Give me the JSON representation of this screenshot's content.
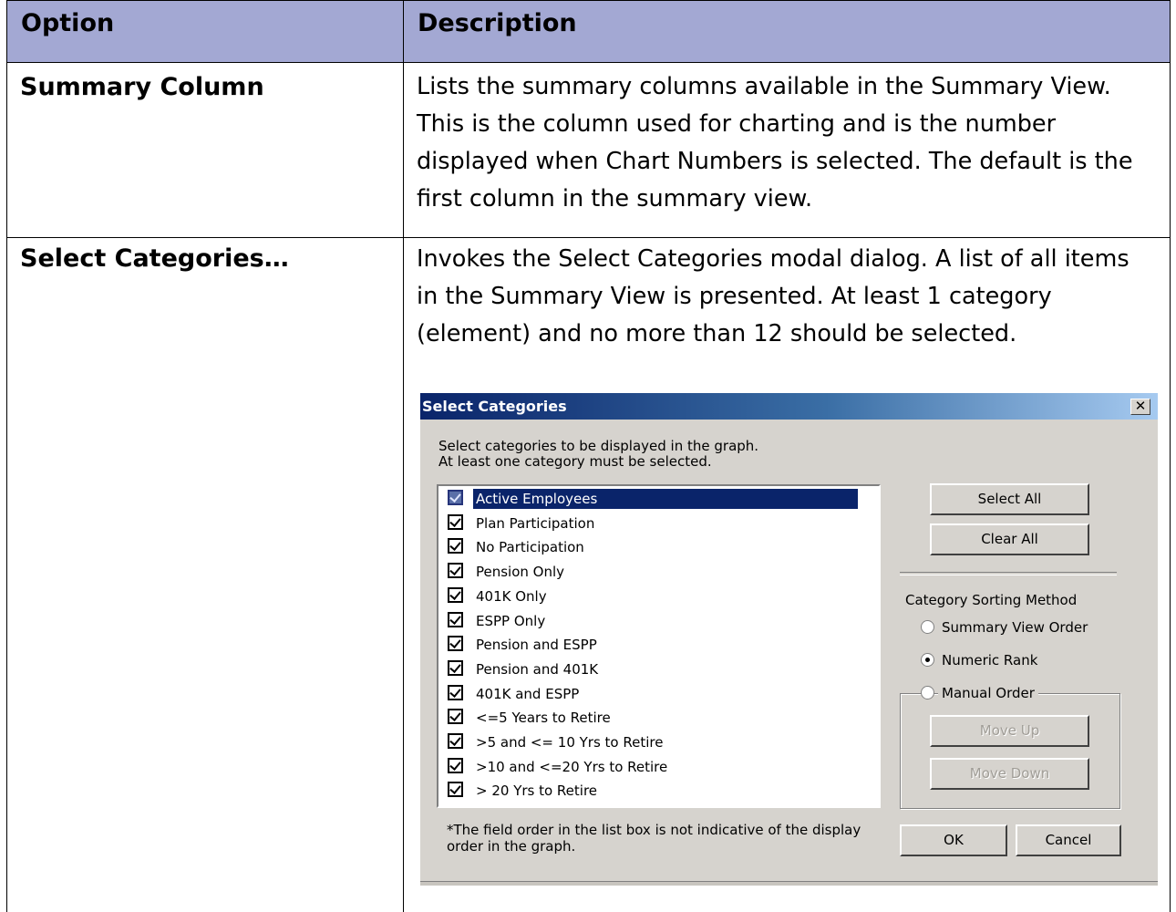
{
  "table": {
    "header": {
      "option": "Option",
      "description": "Description"
    },
    "rows": [
      {
        "option": "Summary Column",
        "description_lines": [
          "Lists the summary columns available in the Summary View.",
          "This is the column used for charting and is the number",
          "displayed when Chart Numbers is selected.  The default is the",
          "first column in the summary view."
        ]
      },
      {
        "option": "Select Categories…",
        "description_lines": [
          "Invokes the Select Categories modal dialog.  A list of all items",
          "in the Summary View is presented.  At least 1 category",
          "(element) and no more than 12 should be selected."
        ]
      }
    ]
  },
  "dialog": {
    "title": "Select Categories",
    "instructions": [
      "Select categories to be displayed in the graph.",
      "At least one category must be selected."
    ],
    "categories": [
      {
        "label": "Active Employees",
        "checked": true,
        "selected": true
      },
      {
        "label": "Plan Participation",
        "checked": true
      },
      {
        "label": "No Participation",
        "checked": true
      },
      {
        "label": "Pension Only",
        "checked": true
      },
      {
        "label": "401K Only",
        "checked": true
      },
      {
        "label": "ESPP Only",
        "checked": true
      },
      {
        "label": "Pension and ESPP",
        "checked": true
      },
      {
        "label": "Pension and 401K",
        "checked": true
      },
      {
        "label": "401K and ESPP",
        "checked": true
      },
      {
        "label": "<=5 Years to Retire",
        "checked": true
      },
      {
        "label": ">5 and <= 10 Yrs to Retire",
        "checked": true
      },
      {
        "label": ">10 and <=20 Yrs to Retire",
        "checked": true
      },
      {
        "label": "> 20 Yrs to Retire",
        "checked": true
      }
    ],
    "buttons": {
      "select_all": "Select All",
      "clear_all": "Clear All",
      "move_up": "Move Up",
      "move_down": "Move Down",
      "ok": "OK",
      "cancel": "Cancel"
    },
    "sorting": {
      "label": "Category Sorting Method",
      "options": [
        {
          "label": "Summary View Order",
          "selected": false
        },
        {
          "label": "Numeric Rank",
          "selected": true
        },
        {
          "label": "Manual Order",
          "selected": false
        }
      ]
    },
    "note": [
      "*The field order in the list box is not indicative of the display",
      "order in the graph."
    ],
    "close_glyph": "✕"
  }
}
